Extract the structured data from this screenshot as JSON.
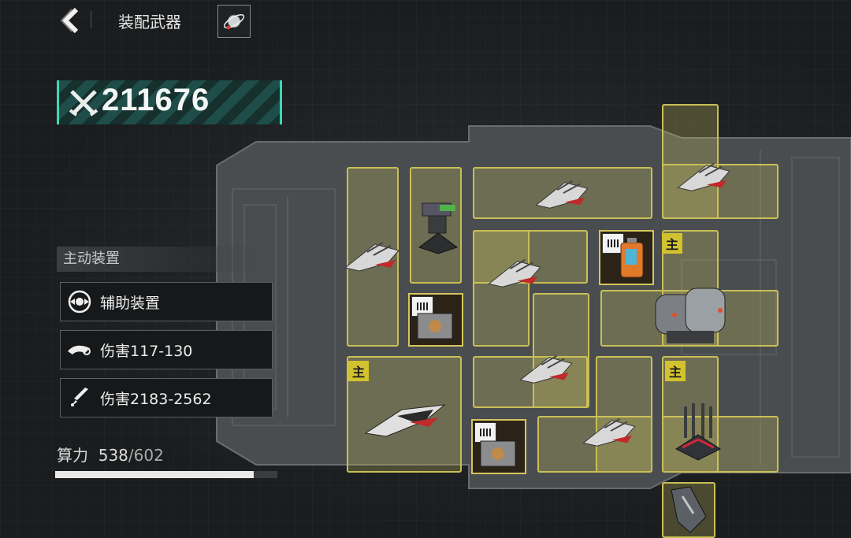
{
  "header": {
    "title": "装配武器"
  },
  "power": {
    "value": "211676"
  },
  "panel": {
    "section_title": "主动装置",
    "stats": [
      {
        "icon": "auxiliary-device-icon",
        "label": "辅助装置"
      },
      {
        "icon": "drone-icon",
        "label": "伤害117-130"
      },
      {
        "icon": "missile-icon",
        "label": "伤害2183-2562"
      }
    ]
  },
  "compute": {
    "label": "算力",
    "used": "538",
    "separator": "/",
    "total": "602",
    "fraction": 0.8937
  },
  "slots": {
    "main_badge": "主"
  },
  "colors": {
    "slot_border": "#c9bf56",
    "accent": "#3ed8b5",
    "badge": "#d3c22f"
  }
}
